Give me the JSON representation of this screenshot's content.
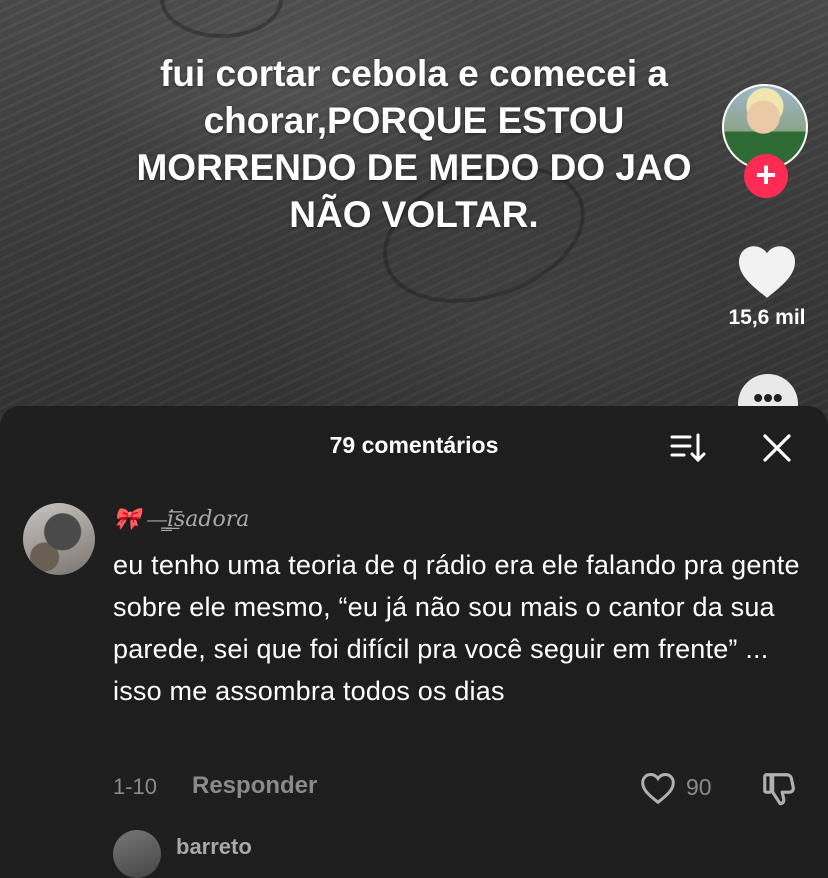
{
  "video": {
    "overlay_text": "fui cortar cebola e comecei a chorar,PORQUE ESTOU MORRENDO DE MEDO DO JAO NÃO VOLTAR.",
    "like_count": "15,6 mil"
  },
  "colors": {
    "follow_accent": "#fe2c55",
    "sheet_background": "#1e1e1e",
    "muted_text": "#8a8a8a"
  },
  "icons": {
    "follow": "plus-icon",
    "like": "heart-icon",
    "more": "ellipsis-icon",
    "sort": "sort-icon",
    "close": "close-icon",
    "comment_like": "heart-outline-icon",
    "dislike": "thumbs-down-icon"
  },
  "comments_sheet": {
    "title": "79 comentários",
    "comments": [
      {
        "username": "🎀 —̳͟͞͞isadora",
        "text": "eu tenho uma teoria de q rádio era ele falando pra gente sobre ele mesmo, “eu já não sou mais o cantor da sua parede, sei que foi difícil pra você seguir em frente” ... isso me assombra todos os dias",
        "date": "1-10",
        "reply_label": "Responder",
        "like_count": "90"
      }
    ],
    "next_comment": {
      "username": "barreto"
    }
  }
}
